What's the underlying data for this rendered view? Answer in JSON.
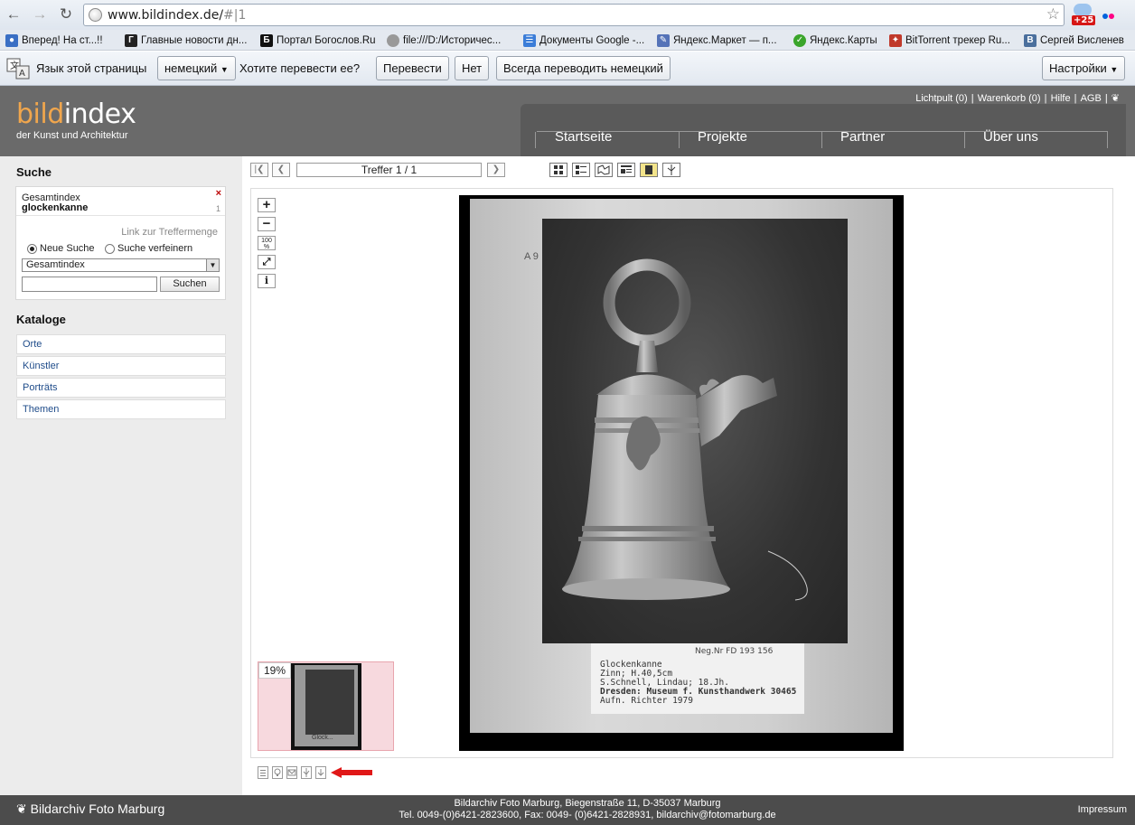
{
  "browser": {
    "url_host": "www.bildindex.de/",
    "url_path": "#|1",
    "badge_count": "+25",
    "bookmarks": [
      {
        "label": "Вперед! На ст...!!",
        "icon": "user-icon",
        "color": "#3a6fc4"
      },
      {
        "label": "Главные новости дн...",
        "icon": "g-icon",
        "color": "#222222"
      },
      {
        "label": "Портал Богослов.Ru",
        "icon": "b-icon",
        "color": "#111111"
      },
      {
        "label": "file:///D:/Историчес...",
        "icon": "globe-icon",
        "color": "#888888"
      },
      {
        "label": "Документы Google -...",
        "icon": "docs-icon",
        "color": "#3b7dd8"
      },
      {
        "label": "Яндекс.Маркет — п...",
        "icon": "market-icon",
        "color": "#5573b8"
      },
      {
        "label": "Яндекс.Карты",
        "icon": "maps-icon",
        "color": "#3aa52b"
      },
      {
        "label": "BitTorrent трекер Ru...",
        "icon": "torrent-icon",
        "color": "#c0392b"
      },
      {
        "label": "Сергей Висленев",
        "icon": "vk-icon",
        "color": "#4a6f9d"
      }
    ]
  },
  "translate_bar": {
    "label": "Язык этой страницы",
    "language": "немецкий",
    "question": "Хотите перевести ее?",
    "translate": "Перевести",
    "no": "Нет",
    "always": "Всегда переводить немецкий",
    "settings": "Настройки"
  },
  "site": {
    "logo_part1": "bild",
    "logo_part2": "index",
    "logo_sub": "der Kunst und Architektur",
    "meta_links": [
      "Lichtpult (0)",
      "Warenkorb (0)",
      "Hilfe",
      "AGB"
    ],
    "nav": [
      "Startseite",
      "Projekte",
      "Partner",
      "Über uns"
    ]
  },
  "sidebar": {
    "search_title": "Suche",
    "search_index": "Gesamtindex",
    "search_term": "glockenkanne",
    "search_count": "1",
    "link_label": "Link zur Treffermenge",
    "radio_new": "Neue Suche",
    "radio_refine": "Suche verfeinern",
    "scope": "Gesamtindex",
    "search_button": "Suchen",
    "catalog_title": "Kataloge",
    "catalogs": [
      "Orte",
      "Künstler",
      "Porträts",
      "Themen"
    ]
  },
  "viewer": {
    "hit_counter": "Treffer 1 / 1",
    "zoom_reset": "100 %",
    "thumb_zoom": "19%",
    "thumb_caption": "Glock...",
    "label": {
      "neg_nr": "Neg.Nr  FD  193 156",
      "line1": "Glockenkanne",
      "line2": "Zinn; H.40,5cm",
      "line3": "S.Schnell, Lindau; 18.Jh.",
      "line4": "Dresden: Museum f. Kunsthandwerk 30465",
      "line5": "Aufn. Richter 1979"
    }
  },
  "footer": {
    "logo": "Bildarchiv Foto Marburg",
    "address": "Bildarchiv Foto Marburg, Biegenstraße 11, D-35037 Marburg",
    "contact": "Tel. 0049-(0)6421-2823600, Fax: 0049- (0)6421-2828931, bildarchiv@fotomarburg.de",
    "impressum": "Impressum"
  },
  "colors": {
    "logo_accent": "#f0a64d",
    "header_bg": "#6a6a6a",
    "footer_bg": "#4c4c4c",
    "link": "#1f4c8a",
    "thumb_bg": "#f7d9de",
    "arrow": "#e01818"
  }
}
